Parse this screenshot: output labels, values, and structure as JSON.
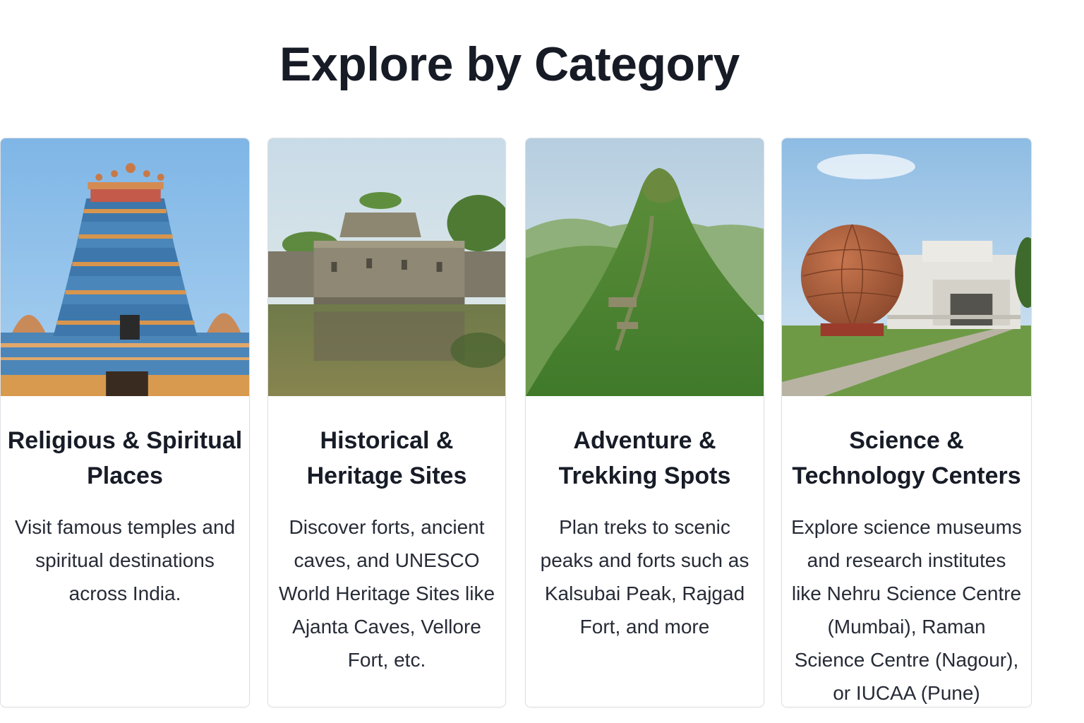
{
  "header": {
    "title": "Explore by Category"
  },
  "categories": [
    {
      "title": "Religious & Spiritual Places",
      "description": "Visit famous temples and spiritual destinations across India.",
      "image": "temple-gopuram-image"
    },
    {
      "title": "Historical & Heritage Sites",
      "description": "Discover forts, ancient caves, and UNESCO World Heritage Sites like Ajanta Caves, Vellore Fort, etc.",
      "image": "moat-fort-image"
    },
    {
      "title": "Adventure & Trekking Spots",
      "description": "Plan treks to scenic peaks and forts such as Kalsubai Peak, Rajgad Fort, and more",
      "image": "green-mountain-peak-image"
    },
    {
      "title": "Science & Technology Centers",
      "description": "Explore science museums and research institutes like Nehru Science Centre (Mumbai), Raman Science Centre (Nagour), or IUCAA (Pune)",
      "image": "science-dome-building-image"
    }
  ]
}
